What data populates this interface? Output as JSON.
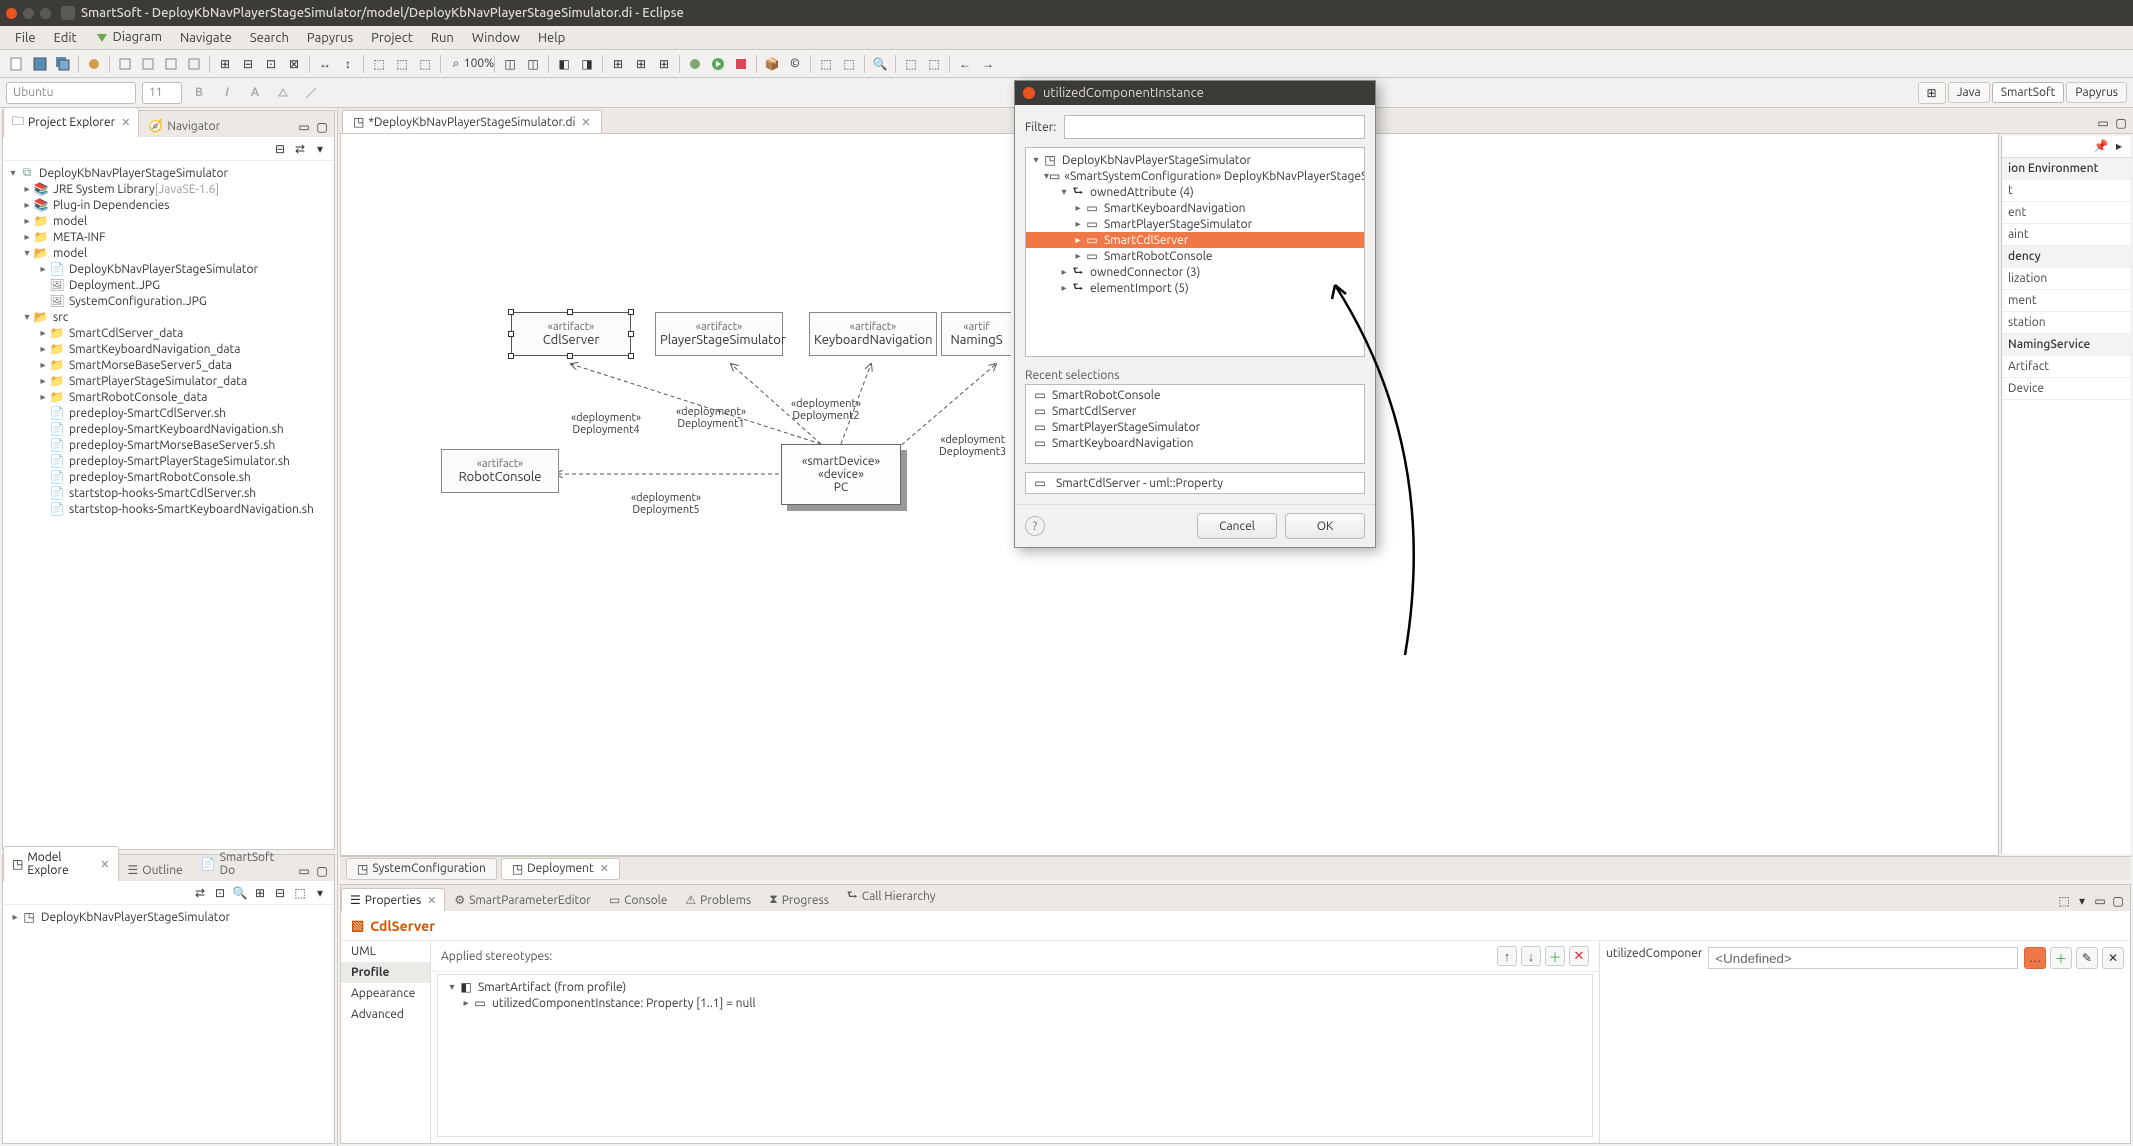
{
  "titlebar": {
    "title": "SmartSoft - DeployKbNavPlayerStageSimulator/model/DeployKbNavPlayerStageSimulator.di - Eclipse"
  },
  "menu": [
    "File",
    "Edit",
    "Diagram",
    "Navigate",
    "Search",
    "Papyrus",
    "Project",
    "Run",
    "Window",
    "Help"
  ],
  "format": {
    "font_name": "Ubuntu",
    "font_size": "11"
  },
  "perspectives": {
    "java": "Java",
    "smartsoft": "SmartSoft",
    "papyrus": "Papyrus"
  },
  "explorer": {
    "title": "Project Explorer",
    "other_tab": "Navigator",
    "tree": {
      "project": "DeployKbNavPlayerStageSimulator",
      "jre": "JRE System Library",
      "jre_ver": "[JavaSE-1.6]",
      "plugin_deps": "Plug-in Dependencies",
      "model": "model",
      "meta_inf": "META-INF",
      "model2": "model",
      "model_children": [
        "DeployKbNavPlayerStageSimulator",
        "Deployment.JPG",
        "SystemConfiguration.JPG"
      ],
      "src": "src",
      "src_children": [
        "SmartCdlServer_data",
        "SmartKeyboardNavigation_data",
        "SmartMorseBaseServer5_data",
        "SmartPlayerStageSimulator_data",
        "SmartRobotConsole_data",
        "predeploy-SmartCdlServer.sh",
        "predeploy-SmartKeyboardNavigation.sh",
        "predeploy-SmartMorseBaseServer5.sh",
        "predeploy-SmartPlayerStageSimulator.sh",
        "predeploy-SmartRobotConsole.sh",
        "startstop-hooks-SmartCdlServer.sh",
        "startstop-hooks-SmartKeyboardNavigation.sh"
      ]
    }
  },
  "outline": {
    "tabs": [
      "Model Explore",
      "Outline",
      "SmartSoft Do"
    ],
    "root": "DeployKbNavPlayerStageSimulator"
  },
  "editor": {
    "tab": "*DeployKbNavPlayerStageSimulator.di",
    "bottom_tabs": {
      "sysconf": "SystemConfiguration",
      "deploy": "Deployment"
    },
    "artifacts": {
      "cdl": {
        "stereo": "«artifact»",
        "name": "CdlServer"
      },
      "player": {
        "stereo": "«artifact»",
        "name": "PlayerStageSimulator"
      },
      "keyboard": {
        "stereo": "«artifact»",
        "name": "KeyboardNavigation"
      },
      "naming": {
        "stereo": "«artif",
        "name": "NamingS"
      },
      "robot": {
        "stereo": "«artifact»",
        "name": "RobotConsole"
      }
    },
    "device": {
      "stereo1": "«smartDevice»",
      "stereo2": "«device»",
      "name": "PC"
    },
    "deployments": {
      "d1": {
        "s": "«deployment»",
        "n": "Deployment1"
      },
      "d2": {
        "s": "«deployment»",
        "n": "Deployment2"
      },
      "d3": {
        "s": "«deployment",
        "n": "Deployment3"
      },
      "d4": {
        "s": "«deployment»",
        "n": "Deployment4"
      },
      "d5": {
        "s": "«deployment»",
        "n": "Deployment5"
      }
    }
  },
  "palette": {
    "items": [
      "ion Environment",
      "t",
      "ent",
      "aint",
      "",
      "dency",
      "lization",
      "ment",
      "station",
      "",
      "NamingService",
      "Artifact",
      "Device"
    ]
  },
  "bottom_views": {
    "tabs": [
      "Properties",
      "SmartParameterEditor",
      "Console",
      "Problems",
      "Progress",
      "Call Hierarchy"
    ],
    "element_name": "CdlServer",
    "side_tabs": [
      "UML",
      "Profile",
      "Appearance",
      "Advanced"
    ],
    "stereo_hdr": "Applied stereotypes:",
    "stereo_root": "SmartArtifact    (from profile)",
    "stereo_child": "utilizedComponentInstance: Property [1..1] = null",
    "util_label": "utilizedComponer",
    "util_value": "<Undefined>"
  },
  "dialog": {
    "title": "utilizedComponentInstance",
    "filter_label": "Filter:",
    "tree": {
      "root": "DeployKbNavPlayerStageSimulator",
      "l1": "«SmartSystemConfiguration» DeployKbNavPlayerStageSi",
      "owned_attr": "ownedAttribute (4)",
      "attrs": [
        "SmartKeyboardNavigation",
        "SmartPlayerStageSimulator",
        "SmartCdlServer",
        "SmartRobotConsole"
      ],
      "owned_conn": "ownedConnector (3)",
      "elem_import": "elementImport (5)"
    },
    "recent_label": "Recent selections",
    "recent": [
      "SmartRobotConsole",
      "SmartCdlServer",
      "SmartPlayerStageSimulator",
      "SmartKeyboardNavigation"
    ],
    "selected": "SmartCdlServer - uml::Property",
    "cancel": "Cancel",
    "ok": "OK"
  }
}
